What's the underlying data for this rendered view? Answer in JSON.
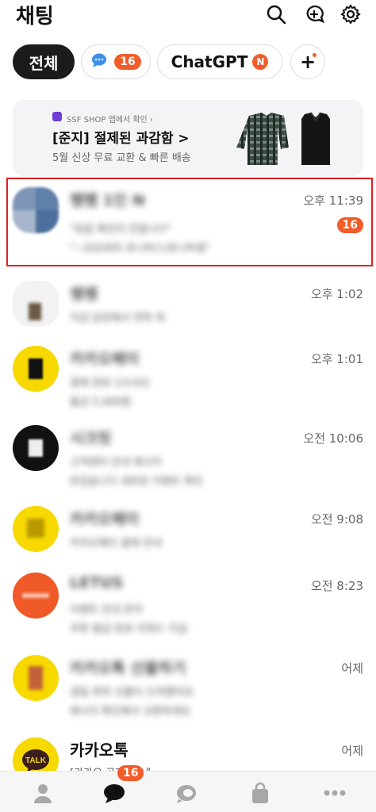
{
  "header": {
    "title": "채팅",
    "icons": [
      "search-icon",
      "new-chat-icon",
      "settings-icon"
    ]
  },
  "filters": [
    {
      "label": "전체",
      "active": true
    },
    {
      "label": "",
      "badge": "16",
      "icon": "chat-bubble-icon"
    },
    {
      "label": "ChatGPT",
      "badge": "N"
    },
    {
      "label": "+"
    }
  ],
  "ad": {
    "source": "SSF SHOP 앱에서 확인 ›",
    "title": "[준지] 절제된 과감함 >",
    "subtitle": "5월 신상 무료 교환 & 빠른 배송"
  },
  "chats": [
    {
      "name": "쨍쨍 1인 N",
      "time": "오후 11:39",
      "unread": "16",
      "preview1": "\"읽음 확인이 안됩니다\"",
      "preview2": "\"~202405 유니버스/유니버셜\"",
      "avatar": "group"
    },
    {
      "name": "쌩쌩",
      "time": "오후 1:02",
      "preview1": "지금 답장해서 연락 줘",
      "preview2": "",
      "avatar": "person"
    },
    {
      "name": "카카오페이",
      "time": "오후 1:01",
      "preview1": "결제 완료 13시01",
      "preview2": "출금 5,000원",
      "avatar": "yellow-b"
    },
    {
      "name": "시크릿",
      "time": "오전 10:06",
      "preview1": "고객센터 안내 메시지",
      "preview2": "반갑습니다 새로운 이벤트 확인",
      "avatar": "black-f"
    },
    {
      "name": "카카오페이",
      "time": "오전 9:08",
      "preview1": "카카오페이 결제 안내",
      "preview2": "",
      "avatar": "yellow-a"
    },
    {
      "name": "LETUS",
      "time": "오전 8:23",
      "preview1": "이벤트 안내 문자",
      "preview2": "쿠폰 발급 완료 리워드 지급",
      "avatar": "orange"
    },
    {
      "name": "카카오톡 선물하기",
      "time": "어제",
      "preview1": "생일 축하 선물이 도착했어요",
      "preview2": "메시지 확인해서 교환하세요",
      "avatar": "yellow-g"
    },
    {
      "name": "카카오톡",
      "time": "어제",
      "preview1": "[카카오 공지] 안내",
      "preview2": "",
      "avatar": "talk"
    }
  ],
  "tabbar": {
    "items": [
      "friends-tab-icon",
      "chats-tab-icon",
      "openchat-tab-icon",
      "shopping-tab-icon",
      "more-tab-icon"
    ],
    "chat_badge": "16"
  },
  "avatar_labels": {
    "talk": "TALK"
  }
}
